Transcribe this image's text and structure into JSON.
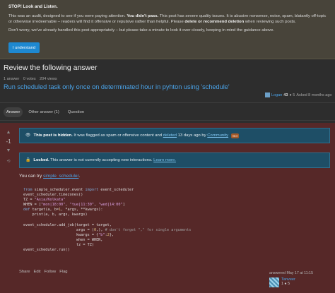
{
  "banner": {
    "title": "STOP! Look and Listen.",
    "text_part1": "This was an audit, designed to see if you were paying attention. ",
    "text_bold1": "You didn't pass.",
    "text_part2": " This post has severe quality issues. It is abusive nonsense, noise, spam, blatantly off-topic or otherwise irredeemable – readers will find it offensive or repulsive rather than helpful. Please ",
    "text_bold2": "delete or recommend deletion",
    "text_part3": " when reviewing such posts.",
    "text2": "Don't worry, we've already handled this post appropriately – but please take a minute to look it over closely, keeping in mind the guidance above.",
    "button_label": "I understand"
  },
  "review": {
    "title": "Review the following answer",
    "answers_count": "1 answer",
    "votes": "0 votes",
    "views": "204 views",
    "question_title": "Run scheduled task only once on determinated hour in pyhton using 'schedule'",
    "asker_name": "Logan",
    "asker_rep": "43",
    "asker_badges": "● 5",
    "asked_time": "Asked 8 months ago"
  },
  "tabs": [
    {
      "label": "Answer"
    },
    {
      "label": "Other answer (1)"
    },
    {
      "label": "Question"
    }
  ],
  "answer": {
    "vote_count": "-1",
    "notice1_bold": "This post is hidden.",
    "notice1_text": " It was flagged as spam or offensive content and ",
    "notice1_link": "deleted",
    "notice1_text2": " 13 days ago by ",
    "notice1_user": "Community",
    "notice1_badge": "Bot",
    "notice2_bold": "Locked.",
    "notice2_text": " This answer is not currently accepting new interactions. ",
    "notice2_link": "Learn more.",
    "try_text": "You can try ",
    "try_link": "simple_scheduler",
    "try_end": ".",
    "actions": [
      "Share",
      "Edit",
      "Follow",
      "Flag"
    ],
    "answered_time": "answered May 17 at 11:15",
    "answerer_name": "Tanveer",
    "answerer_rep": "1 ● 5"
  },
  "colors": {
    "accent": "#1e88d0",
    "link": "#4aa3e8",
    "banner_bg": "#48443a",
    "deleted_bg": "#5a2a2a",
    "notice_bg": "#1e4e66"
  }
}
